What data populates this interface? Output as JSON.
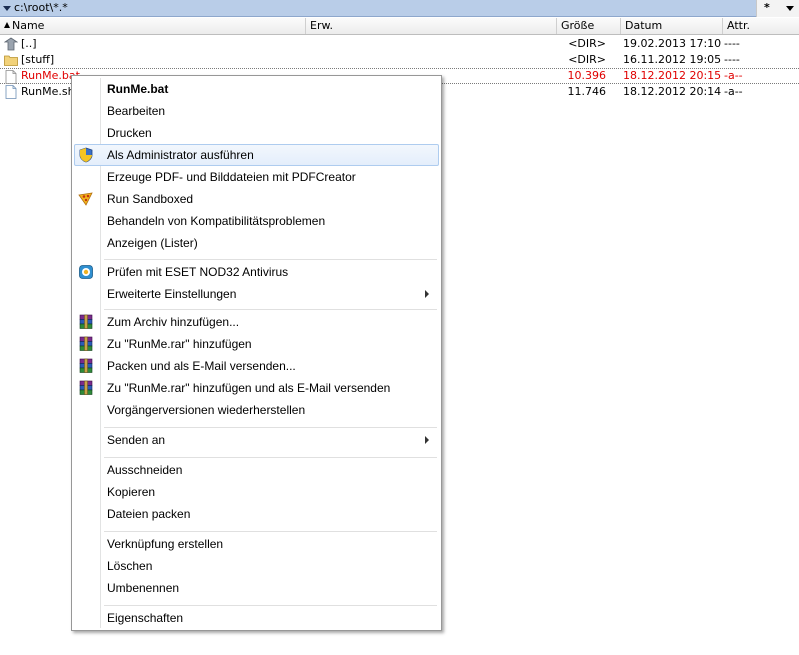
{
  "pathbar": {
    "path": "c:\\root\\*.*",
    "filter": "*"
  },
  "columns": {
    "name": "Name",
    "ext": "Erw.",
    "size": "Größe",
    "date": "Datum",
    "attr": "Attr."
  },
  "files": [
    {
      "name": "[..]",
      "size": "<DIR>",
      "date": "19.02.2013 17:10",
      "attr": "----",
      "icon": "parent-folder-icon"
    },
    {
      "name": "[stuff]",
      "size": "<DIR>",
      "date": "16.11.2012 19:05",
      "attr": "----",
      "icon": "folder-icon"
    },
    {
      "name": "RunMe.bat",
      "size": "10.396",
      "date": "18.12.2012 20:15",
      "attr": "-a--",
      "icon": "file-icon",
      "color": "#e00000"
    },
    {
      "name": "RunMe.sh",
      "size": "11.746",
      "date": "18.12.2012 20:14",
      "attr": "-a--",
      "icon": "file-icon"
    }
  ],
  "menu": {
    "open": "RunMe.bat",
    "edit": "Bearbeiten",
    "print": "Drucken",
    "runas": "Als Administrator ausführen",
    "pdf": "Erzeuge PDF- und Bilddateien mit PDFCreator",
    "sandbox": "Run Sandboxed",
    "compat": "Behandeln von Kompatibilitätsproblemen",
    "lister": "Anzeigen (Lister)",
    "eset": "Prüfen mit ESET NOD32 Antivirus",
    "advanced": "Erweiterte Einstellungen",
    "archive": "Zum Archiv hinzufügen...",
    "addrar": "Zu \"RunMe.rar\" hinzufügen",
    "packmail": "Packen und als E-Mail versenden...",
    "addrarmail": "Zu \"RunMe.rar\" hinzufügen und als E-Mail versenden",
    "restore": "Vorgängerversionen wiederherstellen",
    "sendto": "Senden an",
    "cut": "Ausschneiden",
    "copy": "Kopieren",
    "pack": "Dateien packen",
    "shortcut": "Verknüpfung erstellen",
    "delete": "Löschen",
    "rename": "Umbenennen",
    "props": "Eigenschaften"
  },
  "colors": {
    "path_bar": "#b9cde8",
    "selected_file": "#e00000",
    "menu_hover": "#e4eefb"
  }
}
